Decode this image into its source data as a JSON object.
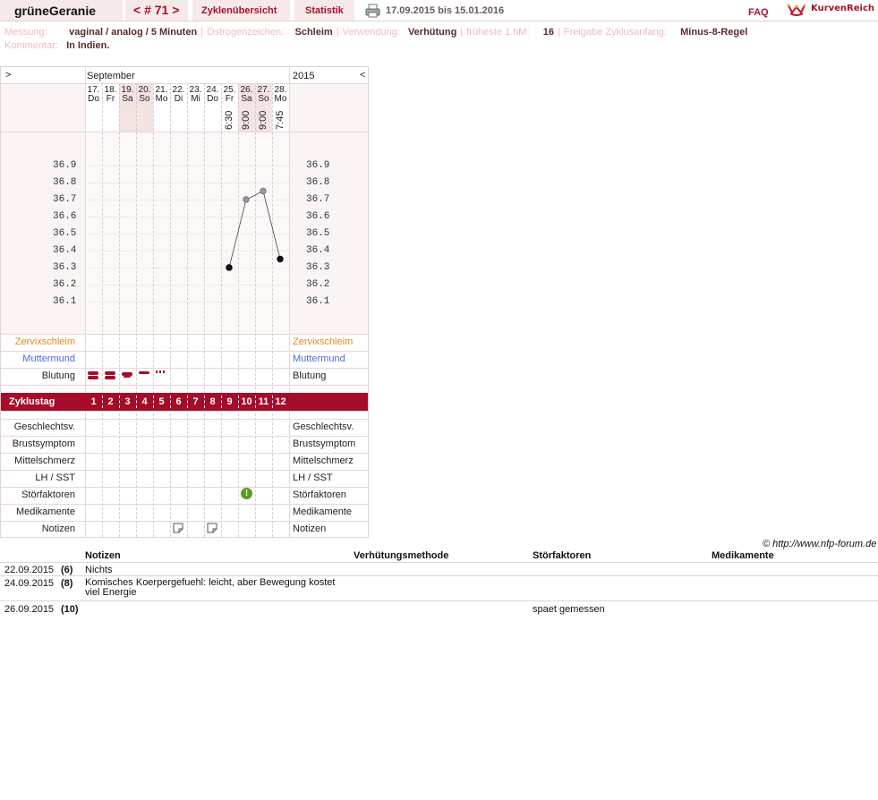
{
  "header": {
    "app_name": "grüneGeranie",
    "cycle_nav": "< # 71 >",
    "tabs": [
      "Zyklenübersicht",
      "Statistik"
    ],
    "date_range": "17.09.2015 bis 15.01.2016",
    "faq": "FAQ",
    "brand": "KurvenReich"
  },
  "info": {
    "measure_label": "Messung:",
    "measure_value": "vaginal / analog / 5 Minuten",
    "estrogen_label": "Östrogenzeichen:",
    "estrogen_value": "Schleim",
    "usage_label": "Verwendung:",
    "usage_value": "Verhütung",
    "earliest_label": "früheste 1.hM:",
    "earliest_value": "16",
    "release_label": "Freigabe Zyklusanfang:",
    "release_value": "Minus-8-Regel",
    "comment_label": "Kommentar:",
    "comment_value": "In Indien."
  },
  "chart": {
    "nav_prev": ">",
    "nav_next": "<",
    "month": "September",
    "year": "2015",
    "days": [
      {
        "date": "17.",
        "dow": "Do",
        "time": "",
        "weekend": false
      },
      {
        "date": "18.",
        "dow": "Fr",
        "time": "",
        "weekend": false
      },
      {
        "date": "19.",
        "dow": "Sa",
        "time": "",
        "weekend": true
      },
      {
        "date": "20.",
        "dow": "So",
        "time": "",
        "weekend": true
      },
      {
        "date": "21.",
        "dow": "Mo",
        "time": "",
        "weekend": false
      },
      {
        "date": "22.",
        "dow": "Di",
        "time": "",
        "weekend": false
      },
      {
        "date": "23.",
        "dow": "Mi",
        "time": "",
        "weekend": false
      },
      {
        "date": "24.",
        "dow": "Do",
        "time": "",
        "weekend": false
      },
      {
        "date": "25.",
        "dow": "Fr",
        "time": "6:30",
        "weekend": false
      },
      {
        "date": "26.",
        "dow": "Sa",
        "time": "9:00",
        "weekend": true
      },
      {
        "date": "27.",
        "dow": "So",
        "time": "9:00",
        "weekend": true
      },
      {
        "date": "28.",
        "dow": "Mo",
        "time": "7:45",
        "weekend": false
      }
    ],
    "ticks": [
      "36.9",
      "36.8",
      "36.7",
      "36.6",
      "36.5",
      "36.4",
      "36.3",
      "36.2",
      "36.1"
    ],
    "temps": [
      null,
      null,
      null,
      null,
      null,
      null,
      null,
      null,
      36.3,
      36.7,
      36.75,
      36.35
    ],
    "rows_top": [
      "Zervixschleim",
      "Muttermund",
      "Blutung"
    ],
    "cycle_label": "Zyklustag",
    "cycle_days": [
      "1",
      "2",
      "3",
      "4",
      "5",
      "6",
      "7",
      "8",
      "9",
      "10",
      "11",
      "12"
    ],
    "rows_bottom": [
      "Geschlechtsv.",
      "Brustsymptom",
      "Mittelschmerz",
      "LH / SST",
      "Störfaktoren",
      "Medikamente",
      "Notizen"
    ],
    "bleeding": [
      "heavy",
      "heavy",
      "medium",
      "light",
      "spotting",
      "",
      "",
      "",
      "",
      "",
      "",
      ""
    ],
    "colors": {
      "accent": "#a50c29",
      "zervix": "#e08a1e",
      "muttermund": "#4f6bd1",
      "weekend": "#f3e3e3",
      "disturb": "#5a9a2a"
    }
  },
  "copyright": "© http://www.nfp-forum.de",
  "notes": {
    "headers": [
      "Notizen",
      "Verhütungsmethode",
      "Störfaktoren",
      "Medikamente"
    ],
    "rows": [
      {
        "date": "22.09.2015",
        "day": "(6)",
        "note": "Nichts",
        "method": "",
        "disturb": "",
        "meds": ""
      },
      {
        "date": "24.09.2015",
        "day": "(8)",
        "note": "Komisches Koerpergefuehl: leicht, aber Bewegung kostet viel Energie",
        "method": "",
        "disturb": "",
        "meds": ""
      },
      {
        "date": "26.09.2015",
        "day": "(10)",
        "note": "",
        "method": "",
        "disturb": "spaet gemessen",
        "meds": ""
      }
    ]
  }
}
